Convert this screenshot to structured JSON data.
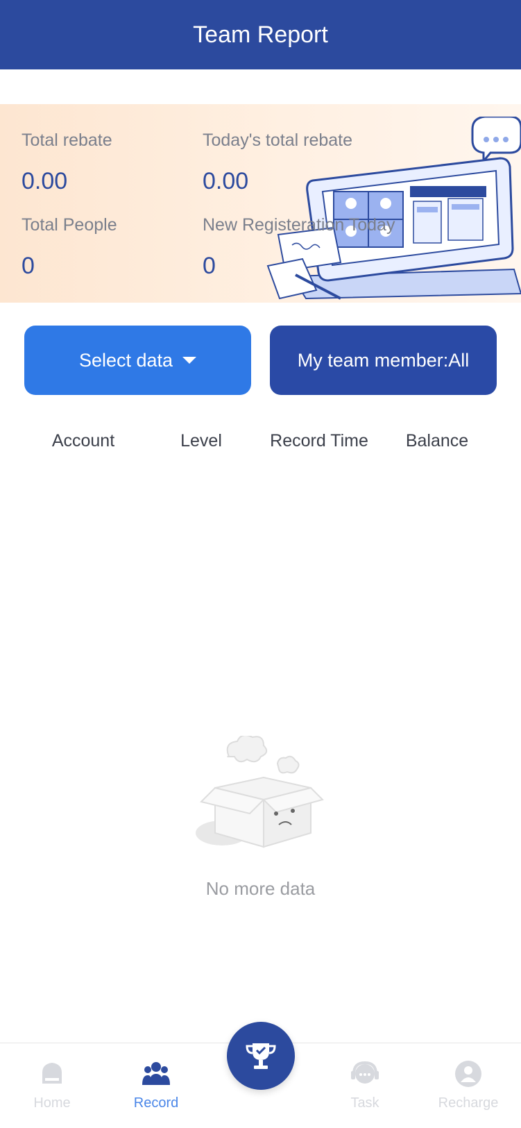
{
  "header": {
    "title": "Team Report"
  },
  "stats": {
    "total_rebate_label": "Total rebate",
    "total_rebate_value": "0.00",
    "today_rebate_label": "Today's total rebate",
    "today_rebate_value": "0.00",
    "total_people_label": "Total People",
    "total_people_value": "0",
    "new_reg_label": "New Registeration Today",
    "new_reg_value": "0"
  },
  "buttons": {
    "select_data": "Select data",
    "team_member": "My team member:All"
  },
  "table": {
    "columns": [
      "Account",
      "Level",
      "Record Time",
      "Balance"
    ]
  },
  "empty": {
    "message": "No more data"
  },
  "tabbar": {
    "items": [
      {
        "label": "Home",
        "icon": "home-icon"
      },
      {
        "label": "Record",
        "icon": "team-icon",
        "active": true
      },
      {
        "label": "",
        "icon": "trophy-icon"
      },
      {
        "label": "Task",
        "icon": "support-icon"
      },
      {
        "label": "Recharge",
        "icon": "user-icon"
      }
    ]
  },
  "colors": {
    "primary": "#2c4a9e",
    "accent": "#2f79e6",
    "active_tab": "#4a86e8"
  }
}
